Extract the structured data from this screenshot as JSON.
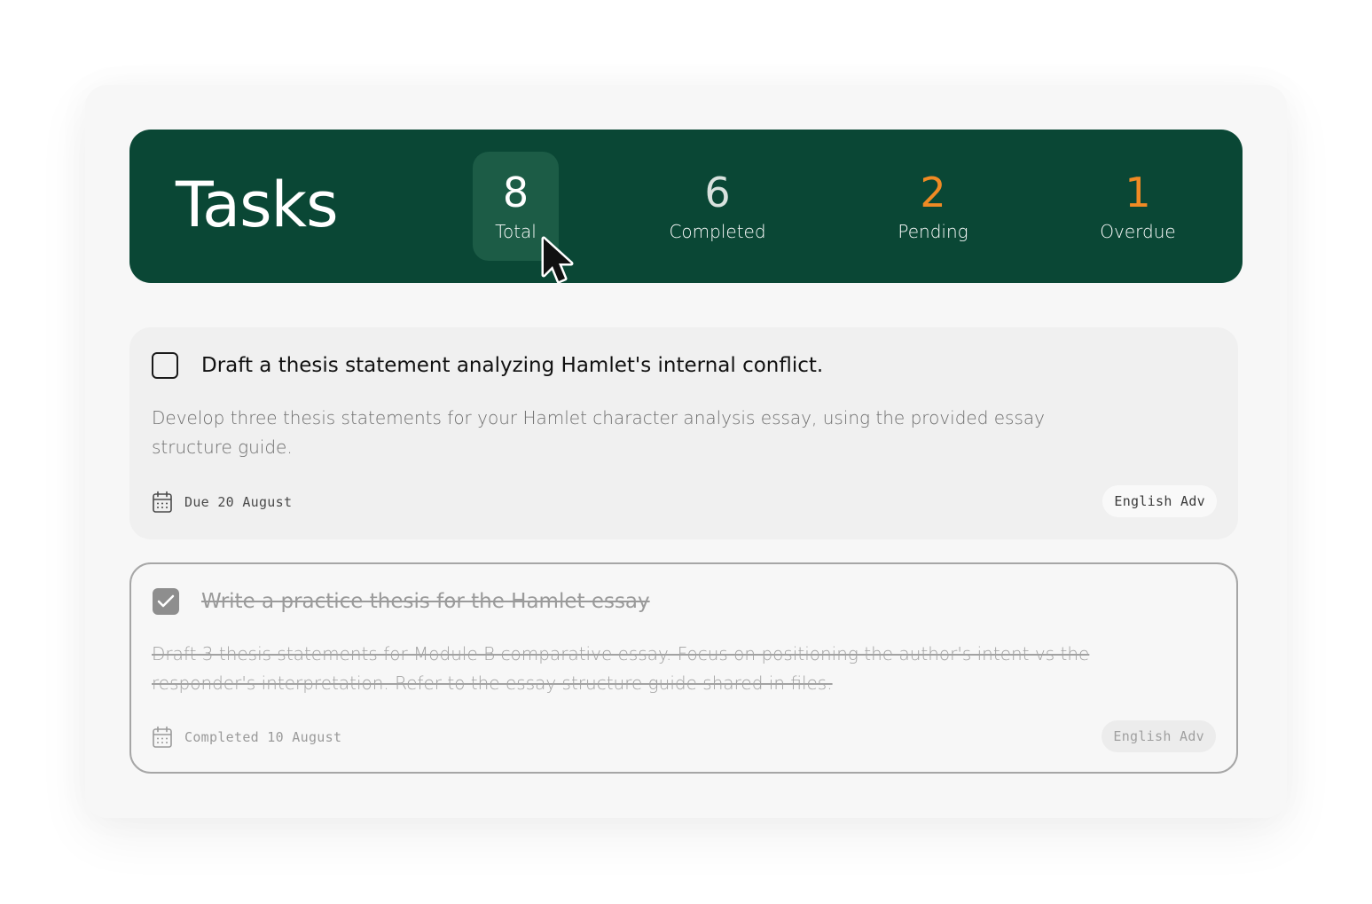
{
  "header": {
    "title": "Tasks",
    "stats": [
      {
        "value": "8",
        "label": "Total",
        "active": true
      },
      {
        "value": "6",
        "label": "Completed"
      },
      {
        "value": "2",
        "label": "Pending",
        "color": "#f08a24"
      },
      {
        "value": "1",
        "label": "Overdue",
        "color": "#f08a24"
      }
    ]
  },
  "tasks": [
    {
      "title": "Draft a thesis statement analyzing Hamlet's internal conflict.",
      "description": "Develop three thesis statements for your Hamlet character analysis essay, using the provided essay structure guide.",
      "date_text": "Due 20 August",
      "tag": "English Adv",
      "completed": false
    },
    {
      "title": "Write a practice thesis for the Hamlet essay",
      "description": "Draft 3 thesis statements for Module B comparative essay. Focus on positioning the author's intent vs the responder's interpretation. Refer to the essay structure guide shared in files.",
      "date_text": "Completed 10 August",
      "tag": "English Adv",
      "completed": true
    }
  ],
  "colors": {
    "header_bg": "#0a4735",
    "active_stat_bg": "#1c5c46",
    "accent_orange": "#f08a24"
  },
  "icons": {
    "date": "calendar-icon",
    "check": "checkmark-icon",
    "pointer": "mouse-cursor-icon"
  }
}
